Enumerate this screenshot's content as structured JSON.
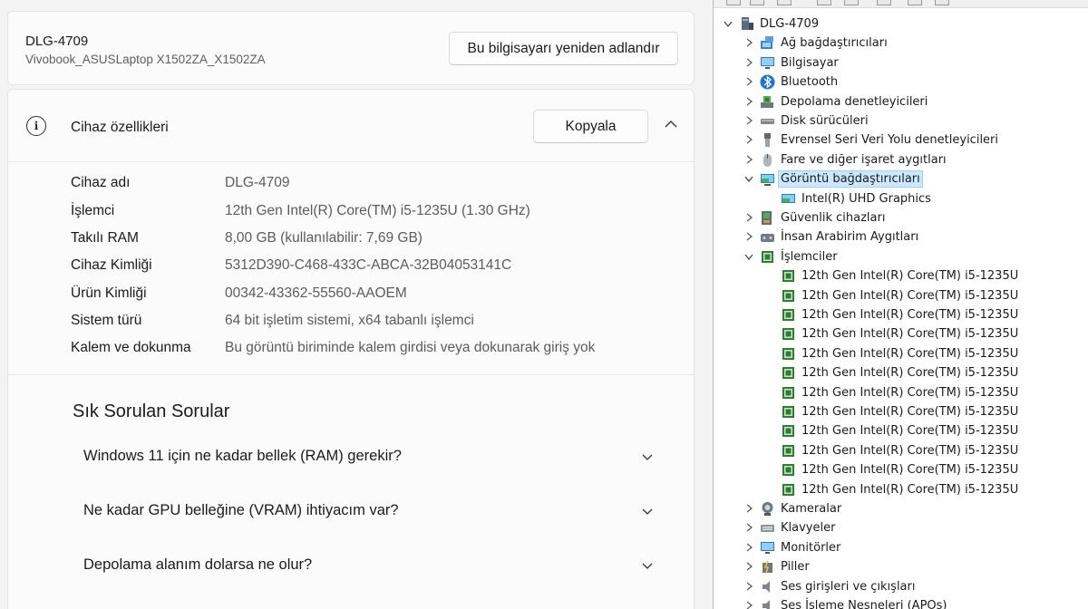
{
  "settings": {
    "device_name": "DLG-4709",
    "device_model": "Vivobook_ASUSLaptop X1502ZA_X1502ZA",
    "rename_button": "Bu bilgisayarı yeniden adlandır",
    "specs": {
      "title": "Cihaz özellikleri",
      "copy_button": "Kopyala",
      "rows": [
        {
          "label": "Cihaz adı",
          "value": "DLG-4709"
        },
        {
          "label": "İşlemci",
          "value": "12th Gen Intel(R) Core(TM) i5-1235U (1.30 GHz)"
        },
        {
          "label": "Takılı RAM",
          "value": "8,00 GB (kullanılabilir: 7,69 GB)"
        },
        {
          "label": "Cihaz Kimliği",
          "value": "5312D390-C468-433C-ABCA-32B04053141C"
        },
        {
          "label": "Ürün Kimliği",
          "value": "00342-43362-55560-AAOEM"
        },
        {
          "label": "Sistem türü",
          "value": "64 bit işletim sistemi, x64 tabanlı işlemci"
        },
        {
          "label": "Kalem ve dokunma",
          "value": "Bu görüntü biriminde kalem girdisi veya dokunarak giriş yok"
        }
      ]
    },
    "faq": {
      "title": "Sık Sorulan Sorular",
      "items": [
        "Windows 11 için ne kadar bellek (RAM) gerekir?",
        "Ne kadar GPU belleğine (VRAM) ihtiyacım var?",
        "Depolama alanım dolarsa ne olur?"
      ]
    }
  },
  "device_manager": {
    "root": "DLG-4709",
    "categories": [
      {
        "label": "Ağ bağdaştırıcıları",
        "icon": "network-adapter-icon",
        "expanded": false
      },
      {
        "label": "Bilgisayar",
        "icon": "computer-icon",
        "expanded": false
      },
      {
        "label": "Bluetooth",
        "icon": "bluetooth-icon",
        "expanded": false
      },
      {
        "label": "Depolama denetleyicileri",
        "icon": "storage-controller-icon",
        "expanded": false
      },
      {
        "label": "Disk sürücüleri",
        "icon": "disk-drive-icon",
        "expanded": false
      },
      {
        "label": "Evrensel Seri Veri Yolu denetleyicileri",
        "icon": "usb-icon",
        "expanded": false
      },
      {
        "label": "Fare ve diğer işaret aygıtları",
        "icon": "mouse-icon",
        "expanded": false
      },
      {
        "label": "Görüntü bağdaştırıcıları",
        "icon": "display-adapter-icon",
        "expanded": true,
        "selected": true,
        "children": [
          "Intel(R) UHD Graphics"
        ]
      },
      {
        "label": "Güvenlik cihazları",
        "icon": "security-device-icon",
        "expanded": false
      },
      {
        "label": "İnsan Arabirim Aygıtları",
        "icon": "hid-icon",
        "expanded": false
      },
      {
        "label": "İşlemciler",
        "icon": "processor-icon",
        "expanded": true,
        "children": [
          "12th Gen Intel(R) Core(TM) i5-1235U",
          "12th Gen Intel(R) Core(TM) i5-1235U",
          "12th Gen Intel(R) Core(TM) i5-1235U",
          "12th Gen Intel(R) Core(TM) i5-1235U",
          "12th Gen Intel(R) Core(TM) i5-1235U",
          "12th Gen Intel(R) Core(TM) i5-1235U",
          "12th Gen Intel(R) Core(TM) i5-1235U",
          "12th Gen Intel(R) Core(TM) i5-1235U",
          "12th Gen Intel(R) Core(TM) i5-1235U",
          "12th Gen Intel(R) Core(TM) i5-1235U",
          "12th Gen Intel(R) Core(TM) i5-1235U",
          "12th Gen Intel(R) Core(TM) i5-1235U"
        ]
      },
      {
        "label": "Kameralar",
        "icon": "camera-icon",
        "expanded": false
      },
      {
        "label": "Klavyeler",
        "icon": "keyboard-icon",
        "expanded": false
      },
      {
        "label": "Monitörler",
        "icon": "monitor-icon",
        "expanded": false
      },
      {
        "label": "Piller",
        "icon": "battery-icon",
        "expanded": false
      },
      {
        "label": "Ses girişleri ve çıkışları",
        "icon": "audio-io-icon",
        "expanded": false
      },
      {
        "label": "Ses İşleme Nesneleri (APOs)",
        "icon": "audio-processing-icon",
        "expanded": false
      }
    ]
  },
  "colors": {
    "accent": "#0067c0",
    "selection": "#cce8ff",
    "chip_green": "#2e7d32"
  }
}
